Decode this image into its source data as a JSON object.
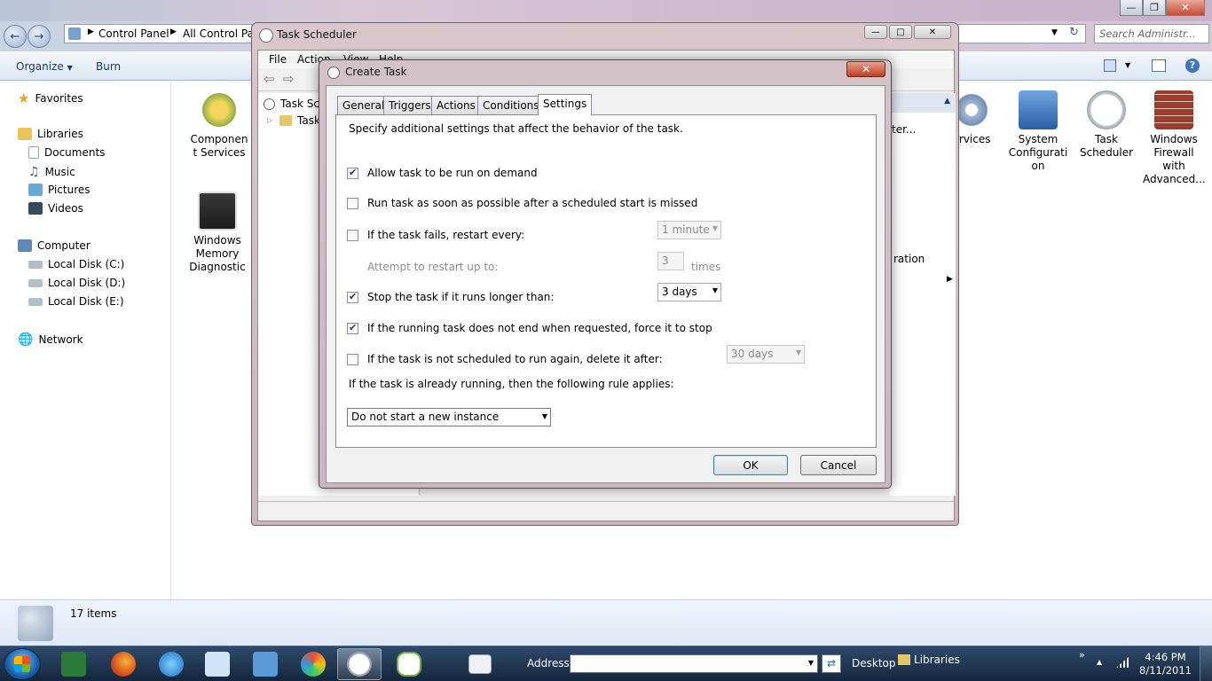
{
  "explorer": {
    "search_placeholder": "Search Administr...",
    "breadcrumb": [
      "Control Panel",
      "All Control Pa"
    ],
    "toolbar": {
      "organize": "Organize",
      "burn": "Burn"
    },
    "nav": {
      "favorites": "Favorites",
      "libraries": "Libraries",
      "documents": "Documents",
      "music": "Music",
      "pictures": "Pictures",
      "videos": "Videos",
      "computer": "Computer",
      "disk_c": "Local Disk (C:)",
      "disk_d": "Local Disk (D:)",
      "disk_e": "Local Disk (E:)",
      "network": "Network"
    },
    "items_left": [
      {
        "label": "Componen t Services"
      },
      {
        "label": "Windows Memory Diagnostic"
      }
    ],
    "items_right": [
      {
        "label": "ervices"
      },
      {
        "label": "System Configurati on"
      },
      {
        "label": "Task Scheduler"
      },
      {
        "label": "Windows Firewall with Advanced..."
      }
    ],
    "status": "17 items"
  },
  "task_scheduler": {
    "title": "Task Scheduler",
    "menu": {
      "file": "File",
      "action": "Action",
      "view": "View",
      "help": "Help"
    },
    "tree": {
      "root": "Task Sch",
      "child": "Task"
    },
    "right_fragments": {
      "a": "ter...",
      "b": "ration"
    }
  },
  "dialog": {
    "title": "Create Task",
    "tabs": [
      "General",
      "Triggers",
      "Actions",
      "Conditions",
      "Settings"
    ],
    "intro": "Specify additional settings that affect the behavior of the task.",
    "settings": {
      "allow_on_demand": {
        "label": "Allow task to be run on demand",
        "checked": true
      },
      "run_asap": {
        "label": "Run task as soon as possible after a scheduled start is missed",
        "checked": false
      },
      "restart_on_fail": {
        "label": "If the task fails, restart every:",
        "checked": false,
        "value": "1 minute"
      },
      "restart_attempts": {
        "label": "Attempt to restart up to:",
        "value": "3",
        "suffix": "times"
      },
      "stop_if_longer": {
        "label": "Stop the task if it runs longer than:",
        "checked": true,
        "value": "3 days"
      },
      "force_stop": {
        "label": "If the running task does not end when requested, force it to stop",
        "checked": true
      },
      "delete_after": {
        "label": "If the task is not scheduled to run again, delete it after:",
        "checked": false,
        "value": "30 days"
      },
      "rule_label": "If the task is already running, then the following rule applies:",
      "rule_value": "Do not start a new instance"
    },
    "ok": "OK",
    "cancel": "Cancel"
  },
  "taskbar": {
    "address_label": "Address",
    "desktop": "Desktop",
    "libraries": "Libraries",
    "time": "4:46 PM",
    "date": "8/11/2011"
  }
}
